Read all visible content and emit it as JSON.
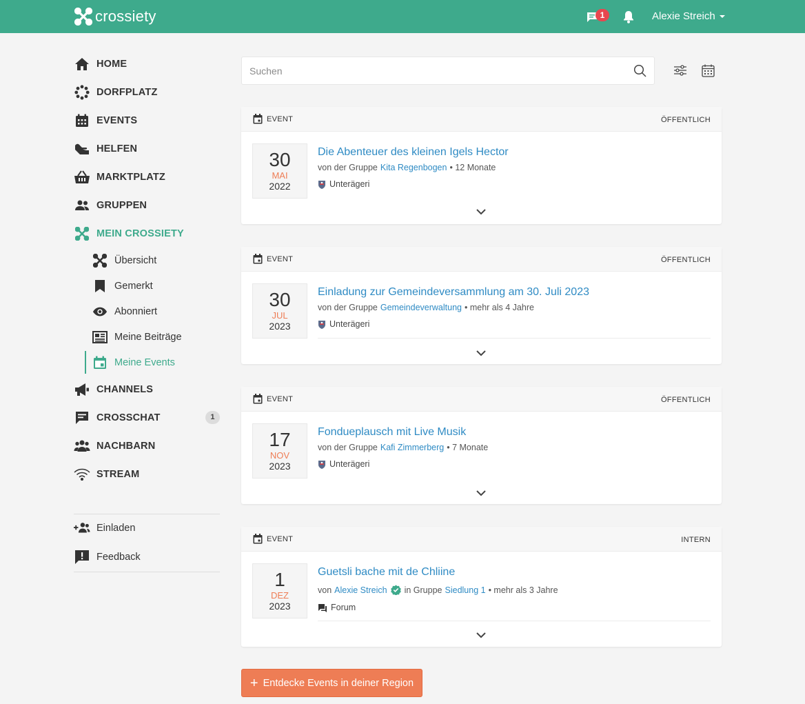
{
  "app": {
    "name": "crossiety",
    "brand_color": "#3eaa8c",
    "accent_orange": "#ee7d55",
    "link_color": "#2f8bc4"
  },
  "topbar": {
    "chat_badge": "1",
    "user_name": "Alexie Streich"
  },
  "sidebar": {
    "items": [
      {
        "label": "HOME",
        "icon": "home-icon"
      },
      {
        "label": "DORFPLATZ",
        "icon": "dorfplatz-icon"
      },
      {
        "label": "EVENTS",
        "icon": "calendar-icon"
      },
      {
        "label": "HELFEN",
        "icon": "helping-hand-icon"
      },
      {
        "label": "MARKTPLATZ",
        "icon": "basket-icon"
      },
      {
        "label": "GRUPPEN",
        "icon": "group-icon"
      },
      {
        "label": "MEIN CROSSIETY",
        "icon": "crossiety-icon"
      }
    ],
    "sub_items": [
      {
        "label": "Übersicht",
        "icon": "overview-icon"
      },
      {
        "label": "Gemerkt",
        "icon": "bookmark-icon"
      },
      {
        "label": "Abonniert",
        "icon": "eye-icon"
      },
      {
        "label": "Meine Beiträge",
        "icon": "newspaper-icon"
      },
      {
        "label": "Meine Events",
        "icon": "event-icon"
      }
    ],
    "items2": [
      {
        "label": "CHANNELS",
        "icon": "megaphone-icon"
      },
      {
        "label": "CROSSCHAT",
        "icon": "chat-icon",
        "badge": "1"
      },
      {
        "label": "NACHBARN",
        "icon": "neighbors-icon"
      },
      {
        "label": "STREAM",
        "icon": "stream-icon"
      }
    ],
    "invite_label": "Einladen",
    "feedback_label": "Feedback"
  },
  "search": {
    "placeholder": "Suchen",
    "value": ""
  },
  "cards": [
    {
      "type": "EVENT",
      "visibility": "ÖFFENTLICH",
      "day": "30",
      "month": "MAI",
      "year": "2022",
      "title": "Die Abenteuer des kleinen Igels Hector",
      "meta_prefix": "von der Gruppe",
      "group": "Kita Regenbogen",
      "meta_suffix": "• 12 Monate",
      "location": "Unterägeri"
    },
    {
      "type": "EVENT",
      "visibility": "ÖFFENTLICH",
      "day": "30",
      "month": "JUL",
      "year": "2023",
      "title": "Einladung zur Gemeindeversammlung am 30. Juli 2023",
      "meta_prefix": "von der Gruppe",
      "group": "Gemeindeverwaltung",
      "meta_suffix": "• mehr als 4 Jahre",
      "location": "Unterägeri"
    },
    {
      "type": "EVENT",
      "visibility": "ÖFFENTLICH",
      "day": "17",
      "month": "NOV",
      "year": "2023",
      "title": "Fondueplausch mit Live Musik",
      "meta_prefix": "von der Gruppe",
      "group": "Kafi Zimmerberg",
      "meta_suffix": "• 7 Monate",
      "location": "Unterägeri"
    },
    {
      "type": "EVENT",
      "visibility": "INTERN",
      "day": "1",
      "month": "DEZ",
      "year": "2023",
      "title": "Guetsli bache mit de Chliine",
      "meta_prefix": "von",
      "author": "Alexie Streich",
      "meta_mid": "in Gruppe",
      "group": "Siedlung 1",
      "meta_suffix": "• mehr als 3 Jahre",
      "location": "Forum"
    }
  ],
  "discover_button": {
    "label": "Entdecke Events in deiner Region"
  }
}
